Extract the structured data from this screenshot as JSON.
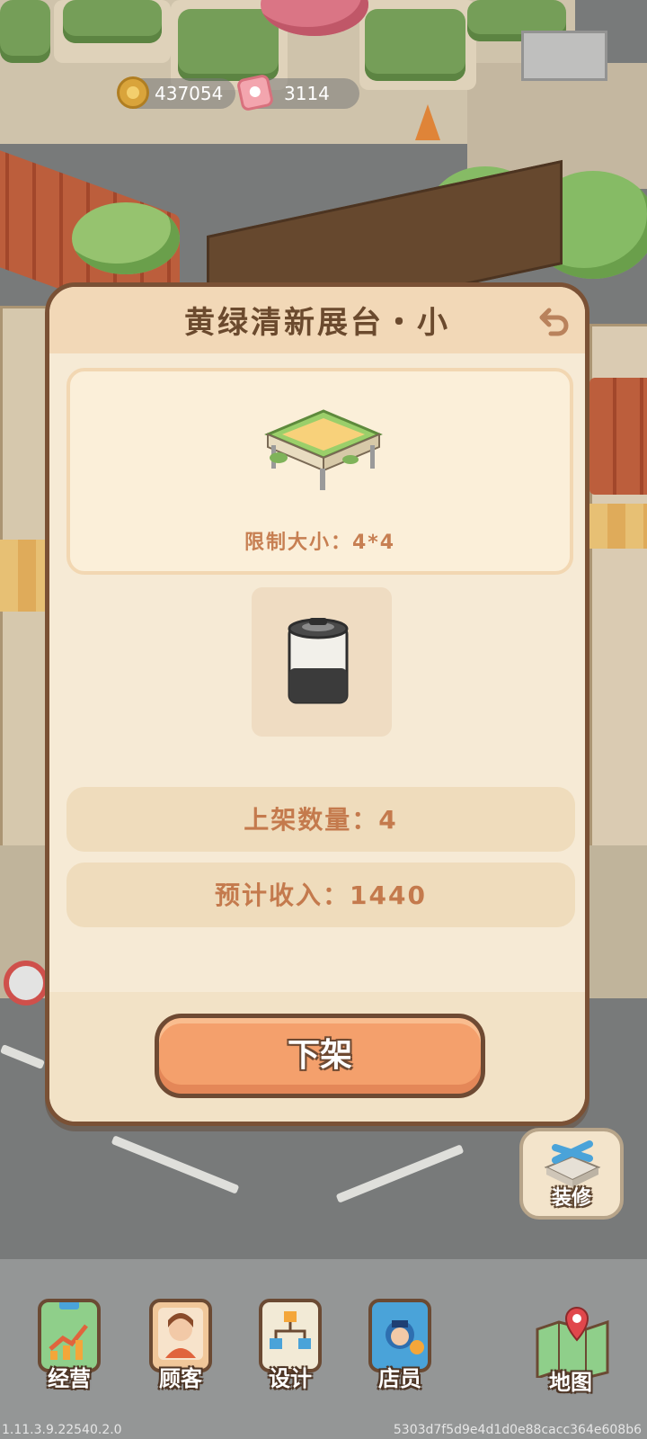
{
  "currency": {
    "coins": "437054",
    "tickets": "3114"
  },
  "dialog": {
    "title": "黄绿清新展台・小",
    "size_limit": "限制大小：4*4",
    "shelf_count": "上架数量：4",
    "expected_income": "预计收入：1440",
    "action_label": "下架"
  },
  "decorate": {
    "label": "装修"
  },
  "nav": {
    "items": [
      {
        "label": "经营"
      },
      {
        "label": "顾客"
      },
      {
        "label": "设计"
      },
      {
        "label": "店员"
      },
      {
        "label": "地图"
      }
    ]
  },
  "footer": {
    "version": "1.11.3.9.22540.2.0",
    "hash": "5303d7f5d9e4d1d0e88cacc364e608b6"
  },
  "colors": {
    "panel_border": "#7a5135",
    "panel_bg": "#fbf1df",
    "text_accent": "#c47a4d",
    "button": "#f4a06c"
  }
}
